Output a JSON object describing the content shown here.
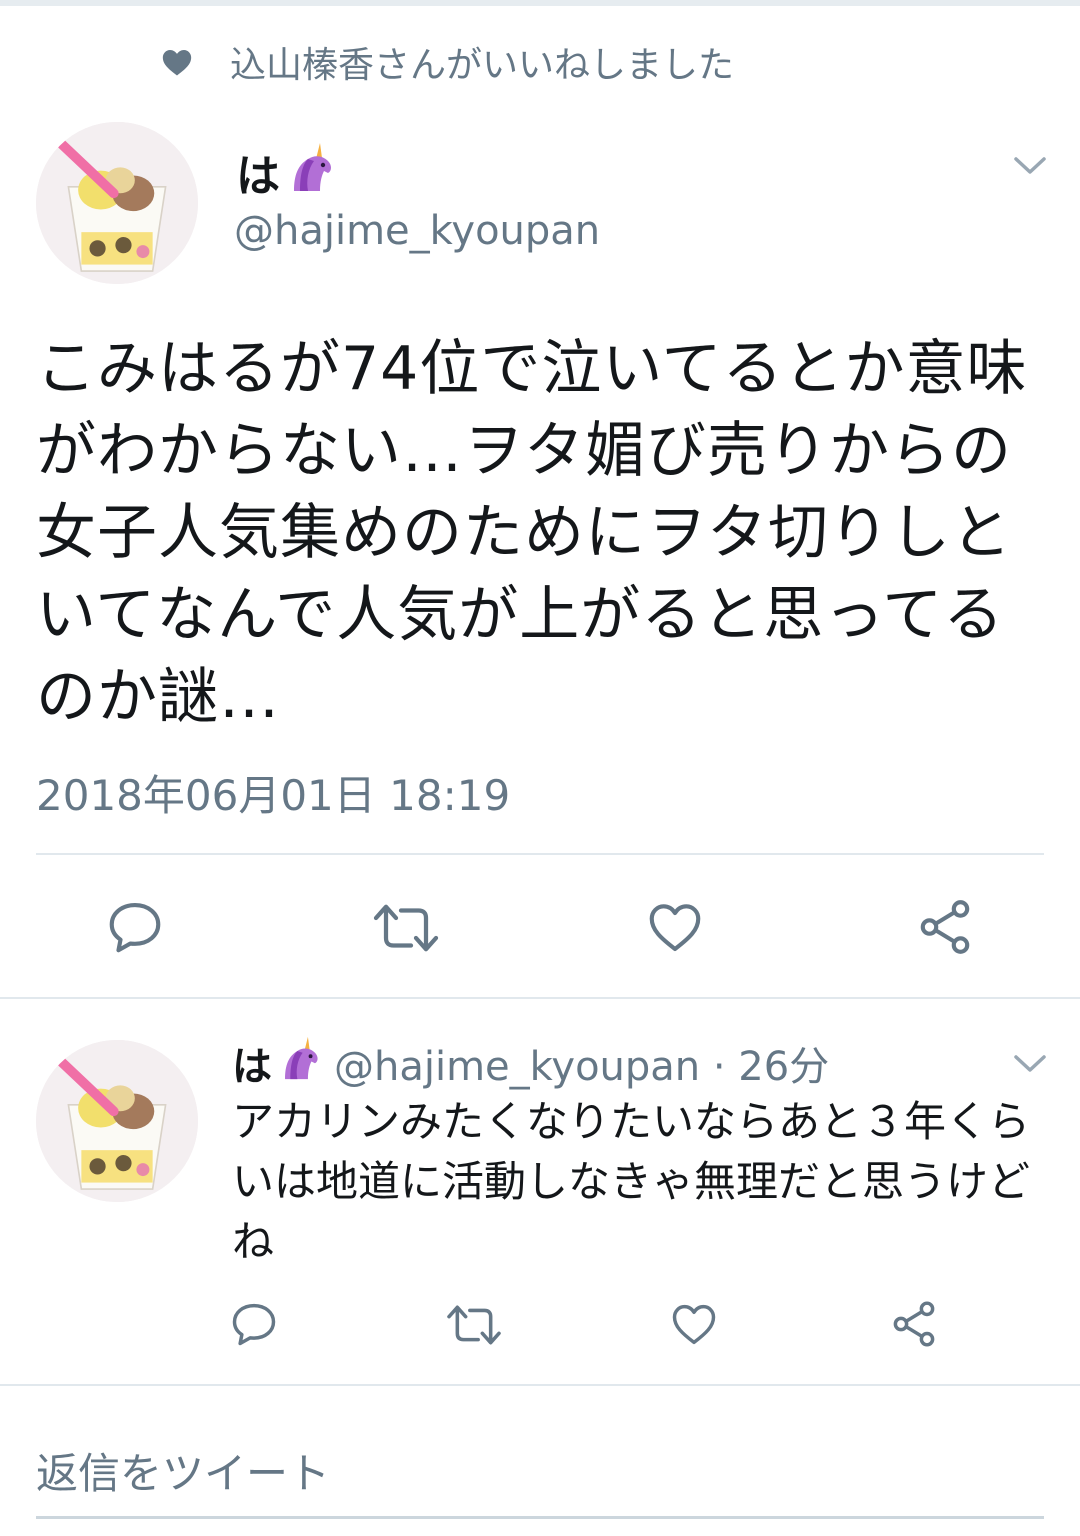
{
  "liked_banner": {
    "text": "込山榛香さんがいいねしました",
    "icon": "heart-icon"
  },
  "tweet": {
    "name": "は",
    "name_emoji": "unicorn-icon",
    "handle": "@hajime_kyoupan",
    "text": "こみはるが74位で泣いてるとか意味がわからない…ヲタ媚び売りからの女子人気集めのためにヲタ切りしといてなんで人気が上がると思ってるのか謎…",
    "timestamp": "2018年06月01日 18:19",
    "actions": [
      "reply-icon",
      "retweet-icon",
      "like-icon",
      "share-icon"
    ]
  },
  "reply": {
    "name": "は",
    "name_emoji": "unicorn-icon",
    "handle_time": "@hajime_kyoupan · 26分",
    "text": "アカリンみたくなりたいならあと３年くらいは地道に活動しなきゃ無理だと思うけどね",
    "actions": [
      "reply-icon",
      "retweet-icon",
      "like-icon",
      "share-icon"
    ]
  },
  "compose": {
    "placeholder": "返信をツイート"
  },
  "colors": {
    "secondary_text": "#657786",
    "icon": "#657786",
    "divider": "#e1e8ed"
  }
}
